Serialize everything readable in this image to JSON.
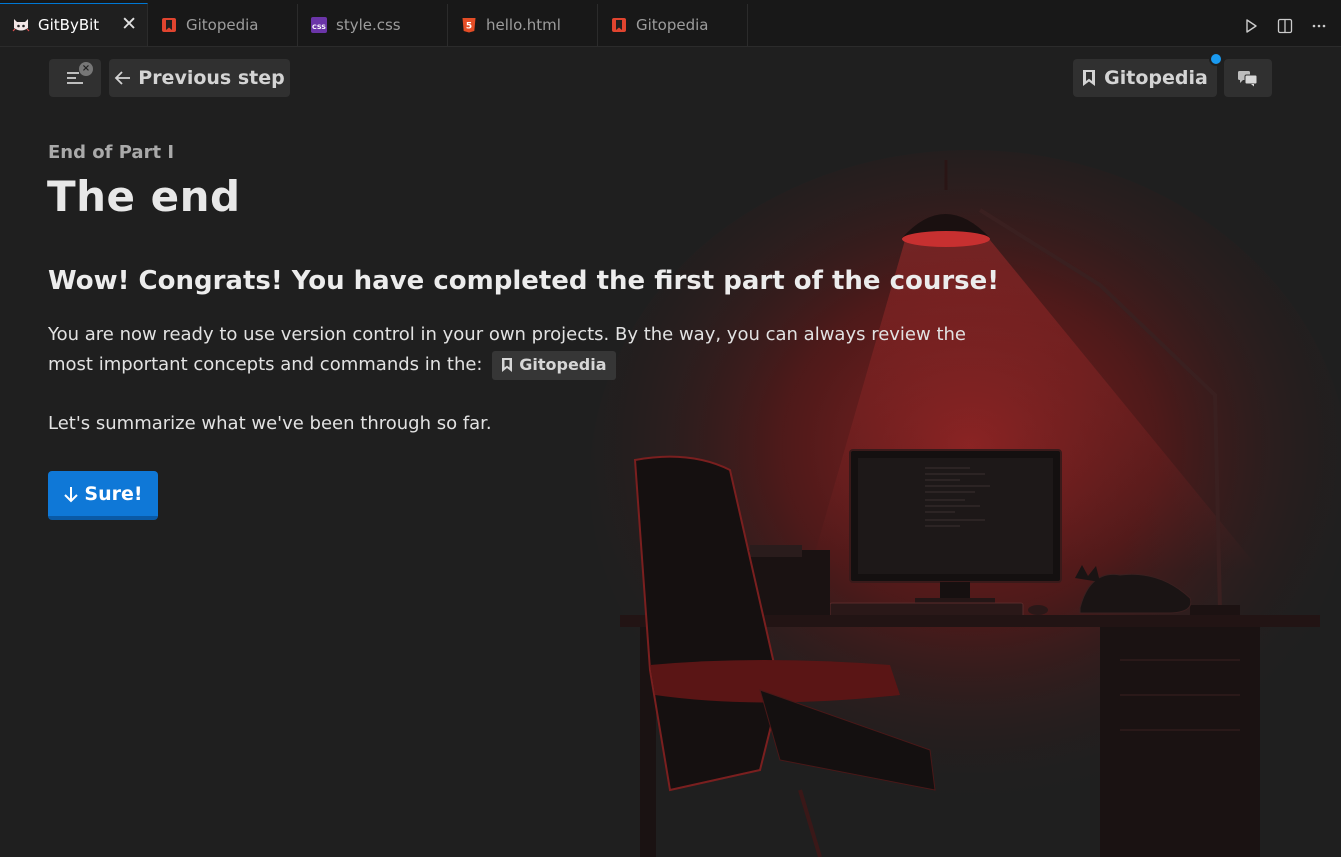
{
  "tabs": [
    {
      "label": "GitByBit",
      "icon": "cat-icon",
      "active": true
    },
    {
      "label": "Gitopedia",
      "icon": "bookmark-icon",
      "active": false
    },
    {
      "label": "style.css",
      "icon": "css-icon",
      "active": false
    },
    {
      "label": "hello.html",
      "icon": "html5-icon",
      "active": false
    },
    {
      "label": "Gitopedia",
      "icon": "bookmark-icon",
      "active": false
    }
  ],
  "toolbar": {
    "menu_badge": "×",
    "prev_label": "Previous step",
    "gitopedia_label": "Gitopedia"
  },
  "content": {
    "eyebrow": "End of Part I",
    "title": "The end",
    "headline": "Wow! Congrats! You have completed the first part of the course!",
    "para_before": "You are now ready to use version control in your own projects. By the way, you can always review the most important concepts and commands in the:",
    "inline_link": "Gitopedia",
    "para2": "Let's summarize what we've been through so far.",
    "sure_label": "Sure!"
  },
  "colors": {
    "background": "#1f1f1f",
    "accent": "#0f78d7",
    "notification_dot": "#1a9af0",
    "scene_glow": "#7a1c1c"
  }
}
